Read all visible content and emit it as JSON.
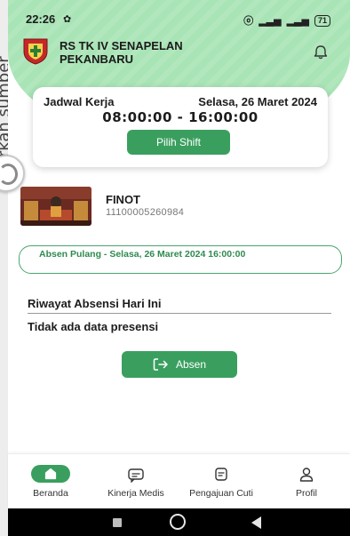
{
  "edge": {
    "cropped_text": "hurkan sumber"
  },
  "status_bar": {
    "time": "22:26",
    "battery": "71"
  },
  "header": {
    "hospital_name_line1": "RS TK IV SENAPELAN",
    "hospital_name_line2": "PEKANBARU"
  },
  "schedule": {
    "label": "Jadwal Kerja",
    "date": "Selasa, 26 Maret 2024",
    "time_range": "08:00:00 - 16:00:00",
    "shift_button": "Pilih Shift"
  },
  "user": {
    "name": "FINOT",
    "nip": "11100005260984"
  },
  "absen_status": {
    "text": "Absen Pulang - Selasa, 26 Maret 2024 16:00:00"
  },
  "history": {
    "title": "Riwayat Absensi Hari Ini",
    "empty_text": "Tidak ada data presensi"
  },
  "absen_button": {
    "label": "Absen"
  },
  "bottom_nav": {
    "items": [
      {
        "label": "Beranda",
        "icon": "home-icon",
        "active": true
      },
      {
        "label": "Kinerja Medis",
        "icon": "chat-icon",
        "active": false
      },
      {
        "label": "Pengajuan Cuti",
        "icon": "document-chat-icon",
        "active": false
      },
      {
        "label": "Profil",
        "icon": "profile-icon",
        "active": false
      }
    ]
  },
  "colors": {
    "accent": "#3a9f5e",
    "header_bg": "#a9e4b6",
    "outline": "#4aa56e"
  }
}
